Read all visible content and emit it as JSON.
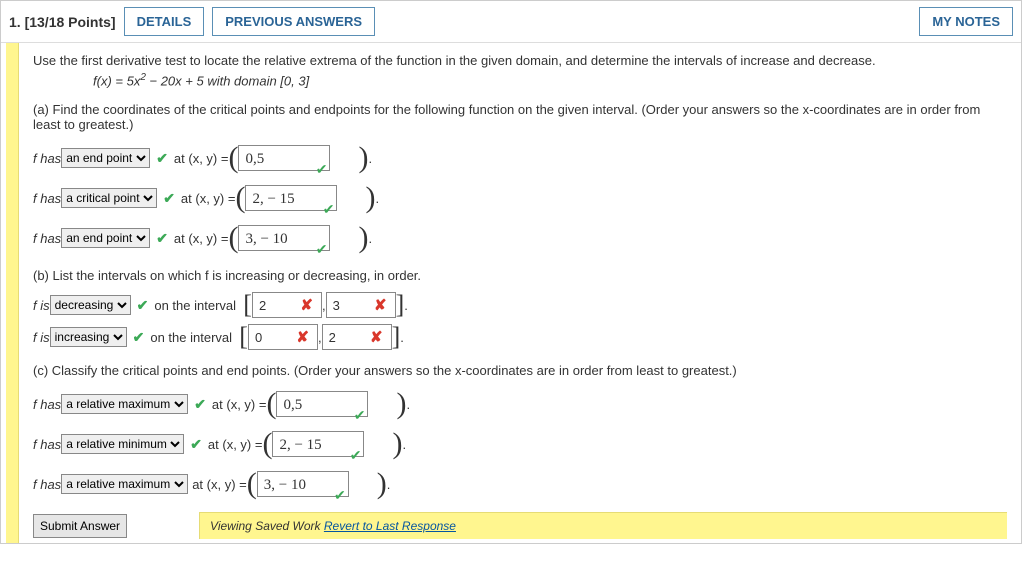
{
  "header": {
    "qnum": "1. [13/18 Points]",
    "details": "DETAILS",
    "previous": "PREVIOUS ANSWERS",
    "mynotes": "MY NOTES"
  },
  "intro": "Use the first derivative test to locate the relative extrema of the function in the given domain, and determine the intervals of increase and decrease.",
  "formula_prefix": "f(x) = 5x",
  "formula_rest": " − 20x + 5 with domain [0, 3]",
  "partA": {
    "text": "(a) Find the coordinates of the critical points and endpoints for the following function on the given interval. (Order your answers so the x-coordinates are in order from least to greatest.)",
    "rows": [
      {
        "sel": "an end point",
        "val": "0,5"
      },
      {
        "sel": "a critical point",
        "val": "2, − 15"
      },
      {
        "sel": "an end point",
        "val": "3, − 10"
      }
    ]
  },
  "labels": {
    "fhas": "f has ",
    "at_xy": "at (x, y) = ",
    "fis": "f is ",
    "on_interval": "on the interval",
    "comma": " , "
  },
  "partB": {
    "text": "(b) List the intervals on which f is increasing or decreasing, in order.",
    "rows": [
      {
        "sel": "decreasing",
        "a": "2",
        "b": "3"
      },
      {
        "sel": "increasing",
        "a": "0",
        "b": "2"
      }
    ]
  },
  "partC": {
    "text": "(c) Classify the critical points and end points. (Order your answers so the x-coordinates are in order from least to greatest.)",
    "rows": [
      {
        "sel": "a relative maximum",
        "val": "0,5",
        "wide": true
      },
      {
        "sel": "a relative minimum",
        "val": "2, − 15",
        "wide": true
      },
      {
        "sel": "a relative maximum",
        "val": "3, − 10",
        "wide": false
      }
    ]
  },
  "submit": "Submit Answer",
  "saved": {
    "text": "Viewing Saved Work ",
    "link": "Revert to Last Response"
  }
}
